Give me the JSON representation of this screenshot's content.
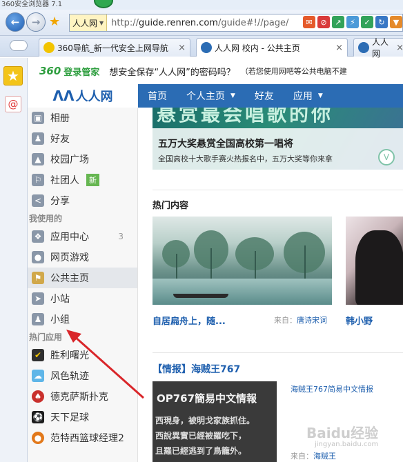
{
  "browser": {
    "title": "360安全浏览器 7.1",
    "site_select": "人人网",
    "url_prefix": "http://",
    "url_host": "guide.renren.com",
    "url_path": "/guide#!//page/",
    "tabs": [
      {
        "label": "360导航_新一代安全上网导航",
        "close": "×"
      },
      {
        "label": "人人网 校内 - 公共主页",
        "close": "×"
      },
      {
        "label": "人人网",
        "close": "×"
      }
    ]
  },
  "notify": {
    "brand_360": "360",
    "brand_mgr": "登录管家",
    "message": "想安全保存“人人网”的密码吗？",
    "info": "（若您使用网吧等公共电脑不建"
  },
  "renren": {
    "logo_text": "人人网",
    "nav": [
      {
        "label": "首页"
      },
      {
        "label": "个人主页"
      },
      {
        "label": "好友"
      },
      {
        "label": "应用"
      }
    ],
    "left_items_top": [
      {
        "label": "相册",
        "icon": "photo-icon"
      },
      {
        "label": "好友",
        "icon": "friend-icon"
      },
      {
        "label": "校园广场",
        "icon": "campus-icon"
      },
      {
        "label": "社团人",
        "icon": "club-icon",
        "badge": "新"
      },
      {
        "label": "分享",
        "icon": "share-icon"
      }
    ],
    "section_using": "我使用的",
    "left_items_using": [
      {
        "label": "应用中心",
        "icon": "app-center-icon",
        "count": "3"
      },
      {
        "label": "网页游戏",
        "icon": "gamepad-icon"
      },
      {
        "label": "公共主页",
        "icon": "bookmark-icon"
      },
      {
        "label": "小站",
        "icon": "signpost-icon"
      },
      {
        "label": "小组",
        "icon": "group-icon"
      }
    ],
    "section_hot": "热门应用",
    "left_items_hot": [
      {
        "label": "胜利曙光",
        "icon": "victory-icon"
      },
      {
        "label": "风色轨迹",
        "icon": "wind-icon"
      },
      {
        "label": "德克萨斯扑克",
        "icon": "poker-icon"
      },
      {
        "label": "天下足球",
        "icon": "football-icon"
      },
      {
        "label": "范特西篮球经理2",
        "icon": "basketball-icon"
      }
    ],
    "banner": {
      "headline": "悬赏最会唱歌的你",
      "title": "五万大奖悬赏全国高校第一唱将",
      "subtitle": "全国高校十大歌手赛火热报名中，五万大奖等你来拿"
    },
    "hot_title": "热门内容",
    "cards": [
      {
        "caption": "自居扁舟上，随...",
        "source_label": "来自：",
        "source": "唐诗宋词"
      },
      {
        "caption": "韩小野"
      }
    ],
    "news": {
      "title": "【情报】海贼王767",
      "img_heading": "OP767簡易中文情報",
      "img_lines": [
        "西現身，被明戈家族抓住。",
        "西說異實已經被羅吃下，",
        "且羅已經逃到了鳥籠外。"
      ],
      "link": "海贼王767简易中文情报",
      "source_label": "来自：",
      "source": "海贼王"
    }
  },
  "watermark": {
    "text": "Baidu经验",
    "sub": "jingyan.baidu.com"
  },
  "colors": {
    "brand_blue": "#2b6cb4",
    "link_blue": "#1e5fae",
    "green_360": "#2e9e3f",
    "arrow_red": "#d9262a"
  }
}
